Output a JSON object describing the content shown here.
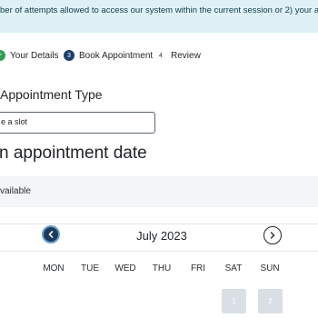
{
  "banner": {
    "text": "ber of attempts allowed to access our system within the current session or 2) your acces"
  },
  "steps": [
    {
      "label": "Your Details",
      "state": "done",
      "marker": "✓"
    },
    {
      "label": "Book Appointment",
      "state": "current",
      "marker": "3"
    },
    {
      "label": "Review",
      "state": "pending",
      "marker": "4"
    }
  ],
  "appointment_type": {
    "label": "Appointment Type",
    "select_value": "e a slot"
  },
  "date_section": {
    "heading": "n appointment date",
    "availability_text": "vailable"
  },
  "calendar": {
    "month_label": "July 2023",
    "weekdays": [
      "MON",
      "TUE",
      "WED",
      "THU",
      "FRI",
      "SAT",
      "SUN"
    ],
    "visible_days": [
      "1",
      "2"
    ]
  },
  "colors": {
    "banner_bg": "#dff1f6",
    "step_done": "#2f9e57",
    "step_current": "#1c3f6e",
    "nav_prev_bg": "#1d3b5c",
    "day_disabled": "#d9dfe5"
  }
}
